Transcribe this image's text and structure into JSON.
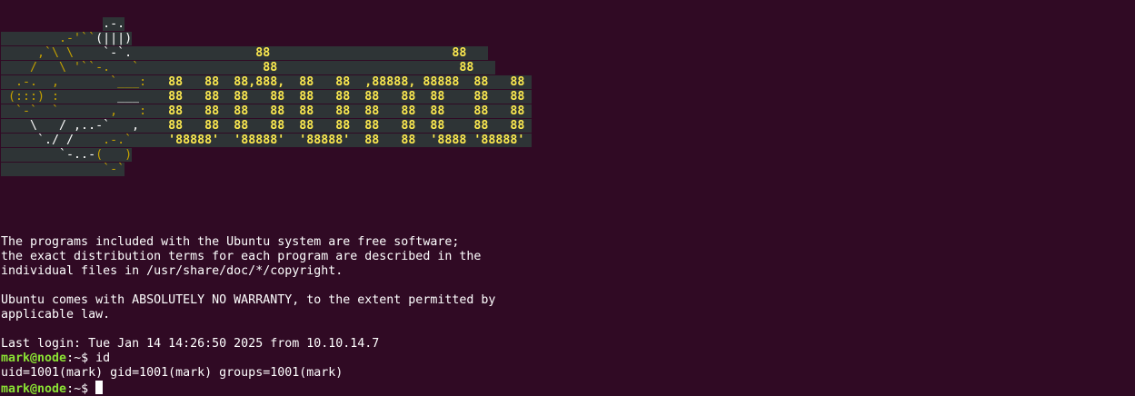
{
  "banner": {
    "lines": [
      [
        {
          "t": "              ",
          "c": "blank"
        },
        {
          "t": ".-.",
          "c": "bg-white"
        }
      ],
      [
        {
          "t": "        .-'``",
          "c": "bg-gold"
        },
        {
          "t": "(|||)",
          "c": "bg-white"
        }
      ],
      [
        {
          "t": "     ,`\\ \\    ",
          "c": "bg-gold"
        },
        {
          "t": "`-`.",
          "c": "bg-white"
        },
        {
          "t": "                 ",
          "c": "bg"
        },
        {
          "t": "88",
          "c": "bg-yellow"
        },
        {
          "t": "                         ",
          "c": "bg"
        },
        {
          "t": "88",
          "c": "bg-yellow"
        },
        {
          "t": "   ",
          "c": "bg"
        }
      ],
      [
        {
          "t": "    /   \\ '``-.   `",
          "c": "bg-gold"
        },
        {
          "t": "                 ",
          "c": "bg"
        },
        {
          "t": "88",
          "c": "bg-yellow"
        },
        {
          "t": "                         ",
          "c": "bg"
        },
        {
          "t": "88",
          "c": "bg-yellow"
        },
        {
          "t": "   ",
          "c": "bg"
        }
      ],
      [
        {
          "t": "  .-.  ,       `___:",
          "c": "bg-gold"
        },
        {
          "t": "   ",
          "c": "bg"
        },
        {
          "t": "88   88  88,888,  88   88  ,88888, 88888  88   88",
          "c": "bg-yellow"
        },
        {
          "t": " ",
          "c": "bg"
        }
      ],
      [
        {
          "t": " (:::) :        ",
          "c": "bg-gold"
        },
        {
          "t": "___",
          "c": "bg-white"
        },
        {
          "t": "    ",
          "c": "bg"
        },
        {
          "t": "88   88  88   88  88   88  88   88  88    88   88",
          "c": "bg-yellow"
        },
        {
          "t": " ",
          "c": "bg"
        }
      ],
      [
        {
          "t": "  `-`  `       ,   :",
          "c": "bg-gold"
        },
        {
          "t": "   ",
          "c": "bg"
        },
        {
          "t": "88   88  88   88  88   88  88   88  88    88   88",
          "c": "bg-yellow"
        },
        {
          "t": " ",
          "c": "bg"
        }
      ],
      [
        {
          "t": "    \\   / ,..-`   ,",
          "c": "bg-white"
        },
        {
          "t": "    ",
          "c": "bg"
        },
        {
          "t": "88   88  88   88  88   88  88   88  88    88   88",
          "c": "bg-yellow"
        },
        {
          "t": " ",
          "c": "bg"
        }
      ],
      [
        {
          "t": "     `./ /    ",
          "c": "bg-white"
        },
        {
          "t": ".-.`",
          "c": "bg-gold"
        },
        {
          "t": "     ",
          "c": "bg"
        },
        {
          "t": "'88888'  '88888'  '88888'  88   88  '8888 '88888'",
          "c": "bg-yellow"
        },
        {
          "t": " ",
          "c": "bg"
        }
      ],
      [
        {
          "t": "        `-..-",
          "c": "bg-white"
        },
        {
          "t": "(   )",
          "c": "bg-gold"
        }
      ],
      [
        {
          "t": "              ",
          "c": "bg"
        },
        {
          "t": "`-`",
          "c": "bg-gold"
        }
      ]
    ]
  },
  "motd": [
    "",
    "",
    "",
    "",
    "The programs included with the Ubuntu system are free software;",
    "the exact distribution terms for each program are described in the",
    "individual files in /usr/share/doc/*/copyright.",
    "",
    "Ubuntu comes with ABSOLUTELY NO WARRANTY, to the extent permitted by",
    "applicable law.",
    "",
    "Last login: Tue Jan 14 14:26:50 2025 from 10.10.14.7"
  ],
  "session": {
    "prompt_user": "mark@node",
    "prompt_path": ":~$ ",
    "command1": "id",
    "output1": "uid=1001(mark) gid=1001(mark) groups=1001(mark)",
    "command2": ""
  }
}
